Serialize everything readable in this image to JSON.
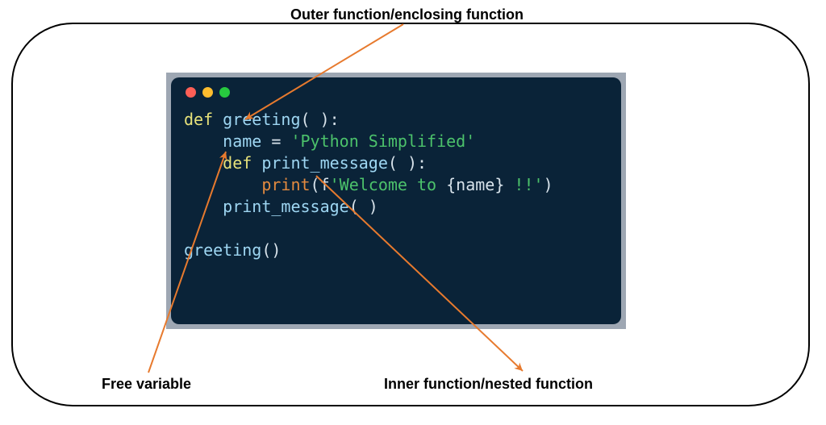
{
  "annotations": {
    "outer": "Outer function/enclosing function",
    "free": "Free variable",
    "inner": "Inner function/nested function"
  },
  "code": {
    "line1_def": "def",
    "line1_name": "greeting",
    "line1_tail": "( ):",
    "line2_indent": "    ",
    "line2_var": "name",
    "line2_eq": " = ",
    "line2_str": "'Python Simplified'",
    "line3_indent": "    ",
    "line3_def": "def",
    "line3_name": "print_message",
    "line3_tail": "( ):",
    "line4_indent": "        ",
    "line4_builtin": "print",
    "line4_open": "(",
    "line4_fprefix": "f",
    "line4_str_a": "'Welcome to ",
    "line4_interp": "{name}",
    "line4_str_b": " !!'",
    "line4_close": ")",
    "line5_indent": "    ",
    "line5_call": "print_message",
    "line5_tail": "( )",
    "line7_call": "greeting",
    "line7_tail": "()"
  },
  "colors": {
    "arrow": "#e77a2e"
  }
}
